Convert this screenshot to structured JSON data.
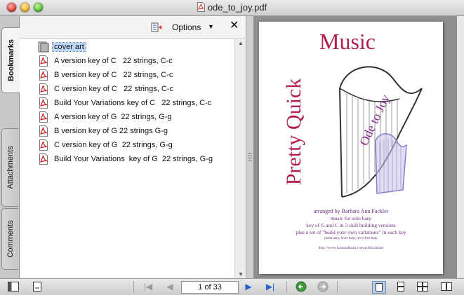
{
  "window": {
    "title": "ode_to_joy.pdf"
  },
  "sidebar_tabs": [
    {
      "label": "Bookmarks",
      "active": true
    },
    {
      "label": "Attachments",
      "active": false
    },
    {
      "label": "Comments",
      "active": false
    }
  ],
  "bookmarks_panel": {
    "options_label": "Options",
    "close_symbol": "✕",
    "items": [
      {
        "label": "cover art",
        "icon": "page-thumbnail-icon",
        "selected": true
      },
      {
        "label": "A version key of C   22 strings, C-c",
        "icon": "pdf-bookmark-icon"
      },
      {
        "label": "B version key of C   22 strings, C-c",
        "icon": "pdf-bookmark-icon"
      },
      {
        "label": "C version key of C   22 strings, C-c",
        "icon": "pdf-bookmark-icon"
      },
      {
        "label": "Build Your Variations key of C   22 strings, C-c",
        "icon": "pdf-bookmark-icon"
      },
      {
        "label": "A version key of G  22 strings, G-g",
        "icon": "pdf-bookmark-icon"
      },
      {
        "label": "B version key of G 22 strings G-g",
        "icon": "pdf-bookmark-icon"
      },
      {
        "label": "C version key of G  22 strings, G-g",
        "icon": "pdf-bookmark-icon"
      },
      {
        "label": "Build Your Variations  key of G  22 strings, G-g",
        "icon": "pdf-bookmark-icon"
      }
    ]
  },
  "document": {
    "cover": {
      "word_music": "Music",
      "word_pretty_quick": "Pretty Quick",
      "word_ode": "Ode to Joy",
      "lines": [
        "arranged by Barbara Ann Fackler",
        "music for solo harp",
        "key of G and C in 3 skill building versions",
        "plus a set of \"build your own variations\" in each key",
        "pedal harp, lever harp, lever-free harp",
        "http://www.homandharp.com/publications"
      ],
      "colors": {
        "title": "#b0204a",
        "ode": "#8a2b8f",
        "text": "#6a2d7a"
      }
    }
  },
  "toolbar": {
    "page_indicator": "1 of 33"
  }
}
